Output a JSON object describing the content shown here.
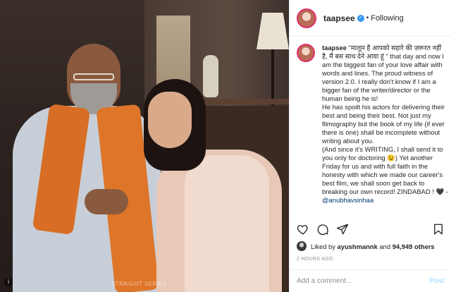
{
  "header": {
    "username": "taapsee",
    "verified_glyph": "✓",
    "separator": "•",
    "follow_state": "Following"
  },
  "caption": {
    "username": "taapsee",
    "text": " \"मालूम है आपको सहारे की ज़रूरत नहीं है, मैं बस साथ देने आया हूं \" that day and now I am the biggest fan of your love affair with words and lines. The proud witness of version 2.0. I really don't know if I am a bigger fan of the writer/director or the human being he is!\nHe has spoilt his actors for delivering their best and being their best. Not just my filmography but the book of my life (if ever there is one) shall be incomplete without writing about you.\n(And since it's WRITING, I shall send it to you only for doctoring 😉) Yet another Friday for us and with full faith in the honesty with which we made our career's best film, we shall soon get back to breaking our own record! ZINDABAD ! 🖤 - ",
    "mention": "@anubhavsinhaa"
  },
  "actions": {
    "icons": [
      "heart-icon",
      "comment-icon",
      "share-icon",
      "bookmark-icon"
    ]
  },
  "likes": {
    "prefix": "Liked by ",
    "user": "ayushmannk",
    "middle": " and ",
    "count": "94,949 others"
  },
  "timestamp": "2 HOURS AGO",
  "comment": {
    "placeholder": "Add a comment...",
    "post_label": "Post"
  },
  "photo": {
    "watermark": "STRAIGHT SERIES",
    "info_glyph": "i"
  },
  "colors": {
    "verified": "#3897f0",
    "story_ring": "#e1306c",
    "mention": "#00376b",
    "post_disabled": "#b2dffc"
  }
}
